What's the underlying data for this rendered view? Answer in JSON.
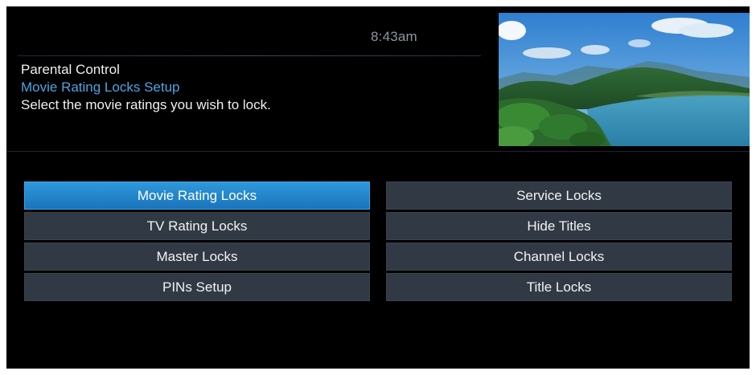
{
  "header": {
    "clock": "8:43am"
  },
  "info": {
    "title": "Parental Control",
    "subtitle": "Movie Rating Locks Setup",
    "description": "Select the movie ratings you wish to lock."
  },
  "menu": {
    "selected": "Movie Rating Locks",
    "items": [
      {
        "label": "Movie Rating Locks"
      },
      {
        "label": "Service Locks"
      },
      {
        "label": "TV Rating Locks"
      },
      {
        "label": "Hide Titles"
      },
      {
        "label": "Master Locks"
      },
      {
        "label": "Channel Locks"
      },
      {
        "label": "PINs Setup"
      },
      {
        "label": "Title Locks"
      }
    ]
  },
  "colors": {
    "accent": "#4aa6e2",
    "selected_button": "#2488cf",
    "button": "#313a44",
    "background": "#000000"
  }
}
